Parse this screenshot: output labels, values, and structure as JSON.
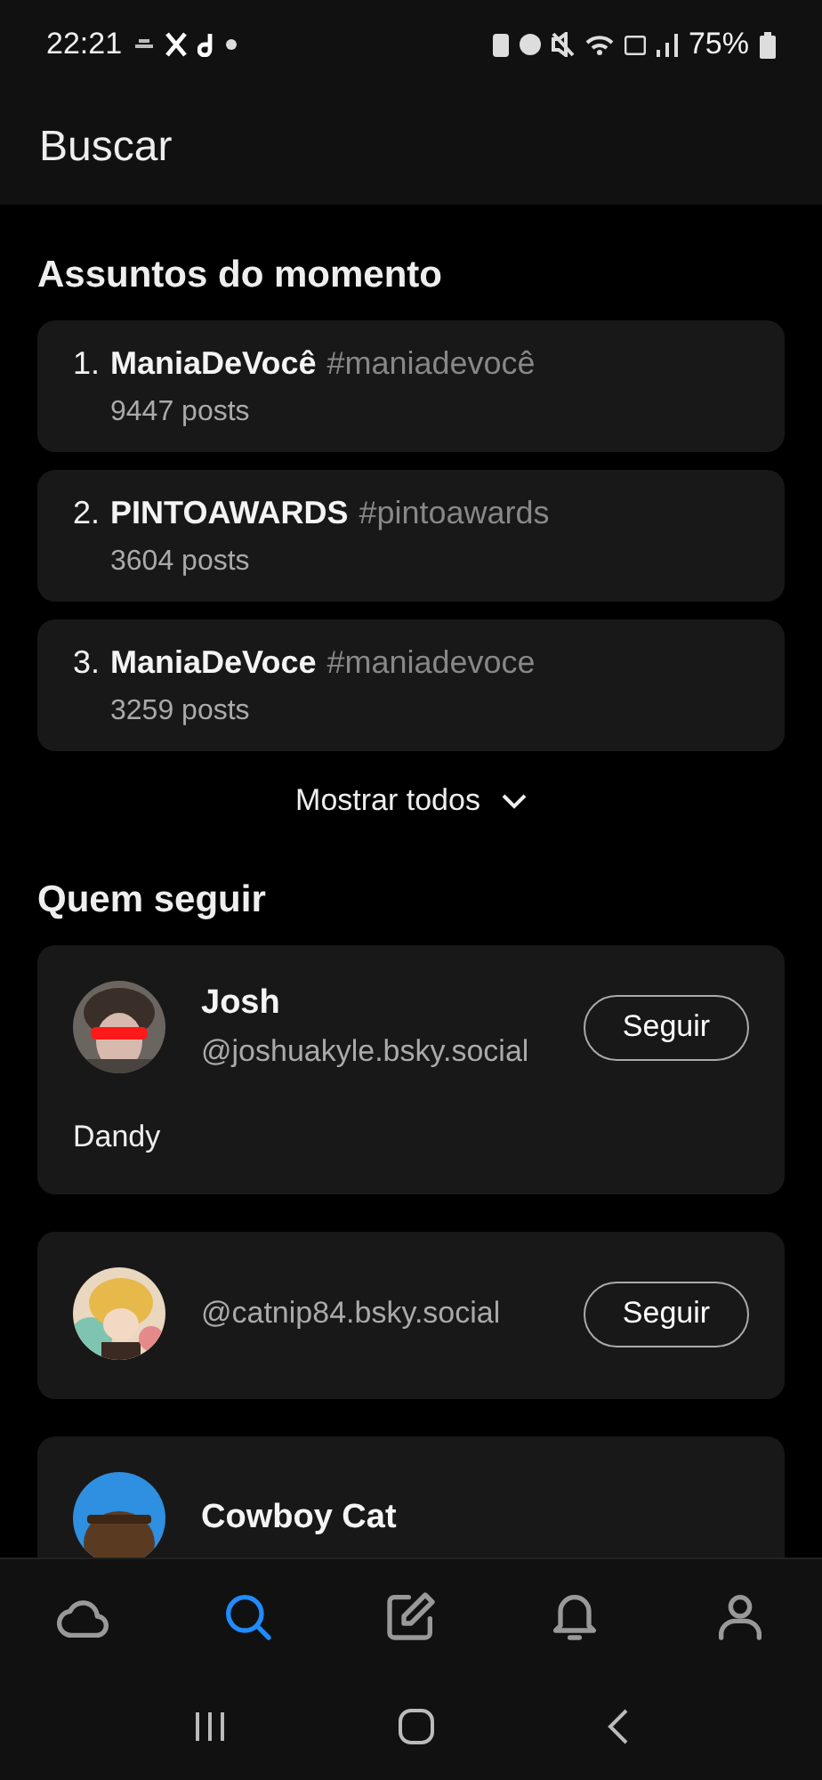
{
  "status_bar": {
    "time": "22:21",
    "battery": "75%"
  },
  "header": {
    "title": "Buscar"
  },
  "trending": {
    "title": "Assuntos do momento",
    "items": [
      {
        "rank": "1.",
        "name": "ManiaDeVocê",
        "tag": "#maniadevocê",
        "posts": "9447 posts"
      },
      {
        "rank": "2.",
        "name": "PINTOAWARDS",
        "tag": "#pintoawards",
        "posts": "3604 posts"
      },
      {
        "rank": "3.",
        "name": "ManiaDeVoce",
        "tag": "#maniadevoce",
        "posts": "3259 posts"
      }
    ],
    "show_all": "Mostrar todos"
  },
  "suggestions": {
    "title": "Quem seguir",
    "users": [
      {
        "name": "Josh",
        "handle": "@joshuakyle.bsky.social",
        "bio": "Dandy",
        "button": "Seguir"
      },
      {
        "handle": "@catnip84.bsky.social",
        "button": "Seguir"
      },
      {
        "name": "Cowboy Cat"
      }
    ]
  },
  "bottom_nav": [
    {
      "kind": "home",
      "selected": false
    },
    {
      "kind": "search",
      "selected": true
    },
    {
      "kind": "compose",
      "selected": false
    },
    {
      "kind": "notifications",
      "selected": false
    },
    {
      "kind": "profile",
      "selected": false
    }
  ]
}
